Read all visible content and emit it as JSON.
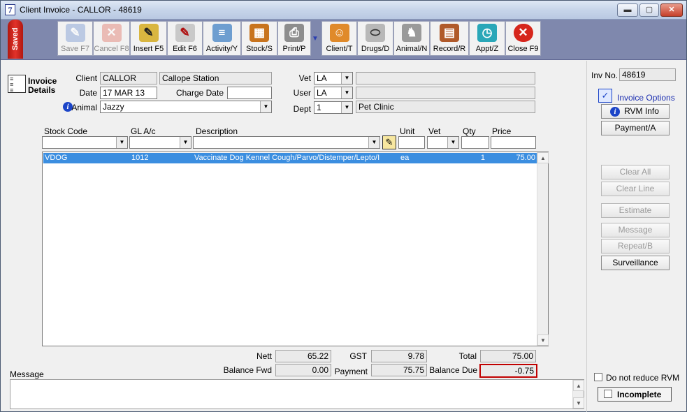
{
  "window": {
    "title": "Client Invoice - CALLOR - 48619",
    "app_icon_glyph": "7",
    "controls": {
      "minimize": "▬",
      "maximize": "▢",
      "close": "✕"
    }
  },
  "toolbar": {
    "saved_label": "Saved",
    "buttons": [
      {
        "label": "Save F7",
        "icon": "save-pen-icon",
        "disabled": true
      },
      {
        "label": "Cancel F8",
        "icon": "cancel-x-icon",
        "disabled": true
      },
      {
        "label": "Insert F5",
        "icon": "insert-pen-icon",
        "disabled": false
      },
      {
        "label": "Edit F6",
        "icon": "edit-pen-icon",
        "disabled": false
      },
      {
        "label": "Activity/Y",
        "icon": "activity-scroll-icon",
        "disabled": false
      },
      {
        "label": "Stock/S",
        "icon": "stock-box-icon",
        "disabled": false
      },
      {
        "label": "Print/P",
        "icon": "printer-icon",
        "disabled": false
      },
      {
        "label": "Client/T",
        "icon": "client-people-icon",
        "disabled": false
      },
      {
        "label": "Drugs/D",
        "icon": "drugs-pill-icon",
        "disabled": false
      },
      {
        "label": "Animal/N",
        "icon": "animal-dog-icon",
        "disabled": false
      },
      {
        "label": "Record/R",
        "icon": "record-files-icon",
        "disabled": false
      },
      {
        "label": "Appt/Z",
        "icon": "appointment-clock-icon",
        "disabled": false
      },
      {
        "label": "Close F9",
        "icon": "close-circle-icon",
        "disabled": false
      }
    ]
  },
  "invoice_details": {
    "heading_line1": "Invoice",
    "heading_line2": "Details",
    "client_label": "Client",
    "client_code": "CALLOR",
    "client_name": "Callope Station",
    "date_label": "Date",
    "date_value": "17 MAR 13",
    "charge_date_label": "Charge Date",
    "charge_date_value": "",
    "animal_label": "Animal",
    "animal_value": "Jazzy",
    "vet_label": "Vet",
    "vet_value": "LA",
    "vet_name": "",
    "user_label": "User",
    "user_value": "LA",
    "user_name": "",
    "dept_label": "Dept",
    "dept_value": "1",
    "dept_name": "Pet Clinic"
  },
  "grid": {
    "headers": {
      "stock_code": "Stock Code",
      "gl": "GL A/c",
      "description": "Description",
      "unit": "Unit",
      "vet": "Vet",
      "qty": "Qty",
      "price": "Price"
    },
    "rows": [
      {
        "stock_code": "VDOG",
        "gl": "1012",
        "description": "Vaccinate Dog Kennel Cough/Parvo/Distemper/Lepto/I",
        "unit": "ea",
        "vet": "",
        "qty": "1",
        "price": "75.00"
      }
    ]
  },
  "totals": {
    "nett_label": "Nett",
    "nett_value": "65.22",
    "gst_label": "GST",
    "gst_value": "9.78",
    "total_label": "Total",
    "total_value": "75.00",
    "balance_fwd_label": "Balance Fwd",
    "balance_fwd_value": "0.00",
    "payment_label": "Payment",
    "payment_value": "75.75",
    "balance_due_label": "Balance Due",
    "balance_due_value": "-0.75"
  },
  "message": {
    "label": "Message",
    "value": ""
  },
  "side": {
    "inv_no_label": "Inv No.",
    "inv_no_value": "48619",
    "invoice_options_label": "Invoice Options",
    "rvm_info": "RVM Info",
    "payment": "Payment/A",
    "clear_all": "Clear All",
    "clear_line": "Clear Line",
    "estimate": "Estimate",
    "message": "Message",
    "repeat": "Repeat/B",
    "surveillance": "Surveillance",
    "do_not_reduce_rvm": "Do not reduce RVM",
    "incomplete": "Incomplete"
  },
  "colors": {
    "selection": "#3b8ee0",
    "balance_due_border": "#c00000",
    "toolbar_bg": "#7f88ad",
    "saved_tab": "#d42a22",
    "info_blue": "#1c45c8"
  }
}
